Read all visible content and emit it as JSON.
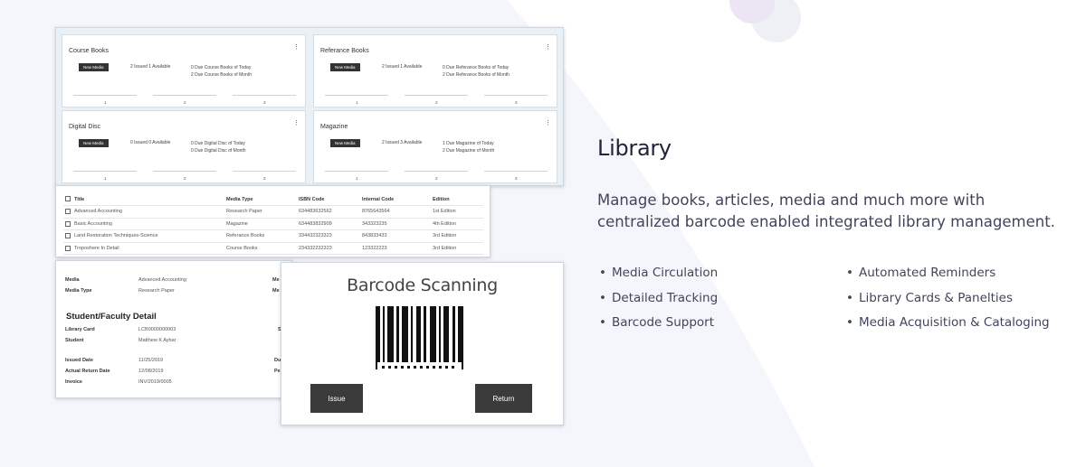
{
  "dashboard": {
    "cards": [
      {
        "title": "Course Books",
        "new_media": "New Media",
        "issued": "2 Issued 1 Available",
        "due_today": "0 Due Course Books of Today",
        "due_month": "2 Due Course Books of Month",
        "ticks": [
          "1",
          "2",
          "3"
        ]
      },
      {
        "title": "Referance Books",
        "new_media": "New Media",
        "issued": "2 Issued 1 Available",
        "due_today": "0 Due Referance Books of Today",
        "due_month": "2 Due Referance Books of Month",
        "ticks": [
          "1",
          "2",
          "3"
        ]
      },
      {
        "title": "Digital Disc",
        "new_media": "New Media",
        "issued": "0 Issued 0 Available",
        "due_today": "0 Due Digital Disc of Today",
        "due_month": "0 Due Digital Disc of Month",
        "ticks": [
          "1",
          "2",
          "3"
        ]
      },
      {
        "title": "Magazine",
        "new_media": "New Media",
        "issued": "2 Issued 3 Available",
        "due_today": "1 Due Magazine of Today",
        "due_month": "2 Due Magazine of Month",
        "ticks": [
          "1",
          "2",
          "3"
        ]
      }
    ],
    "menu_glyph": "⋮"
  },
  "media_table": {
    "headers": [
      "Title",
      "Media Type",
      "ISBN Code",
      "Internal Code",
      "Edition"
    ],
    "rows": [
      [
        "Advanced Accounting",
        "Research Paper",
        "634483632562",
        "8765643564",
        "1st Edition"
      ],
      [
        "Basic Accounting",
        "Magazine",
        "634483832909",
        "343323235",
        "4th Edition"
      ],
      [
        "Land Restoration Techniques-Science",
        "Referance Books",
        "334432323323",
        "843833433",
        "3rd Edition"
      ],
      [
        "Troposhere In Detail",
        "Course Books",
        "234332232323",
        "123322223",
        "3rd Edition"
      ]
    ]
  },
  "detail": {
    "media_label": "Media",
    "media_value": "Advanced Accounting",
    "media_type_label": "Media Type",
    "media_type_value": "Research Paper",
    "section_title": "Student/Faculty Detail",
    "library_card_label": "Library Card",
    "library_card_value": "LCB0000000003",
    "student_label": "Student",
    "student_value": "Matthew K Aybar",
    "issued_date_label": "Issued Date",
    "issued_date_value": "11/25/2019",
    "return_date_label": "Actual Return Date",
    "return_date_value": "12/08/2019",
    "invoice_label": "Invoice",
    "invoice_value": "INV/2019/0005",
    "cut_labels": [
      "Me",
      "Me",
      "S",
      "Du",
      "Pe"
    ]
  },
  "scanner": {
    "title": "Barcode Scanning",
    "issue_label": "Issue",
    "return_label": "Return"
  },
  "content": {
    "heading": "Library",
    "description": "Manage books, articles, media and much more with centralized barcode enabled integrated library management.",
    "features_left": [
      "Media Circulation",
      "Detailed Tracking",
      "Barcode Support"
    ],
    "features_right": [
      "Automated Reminders",
      "Library Cards & Panelties",
      "Media Acquisition & Cataloging"
    ]
  },
  "colors": {
    "page_bg": "#f4f6fb",
    "heading": "#1f2437",
    "button": "#3b3b3b",
    "accent_circle": "#ece5f4"
  }
}
